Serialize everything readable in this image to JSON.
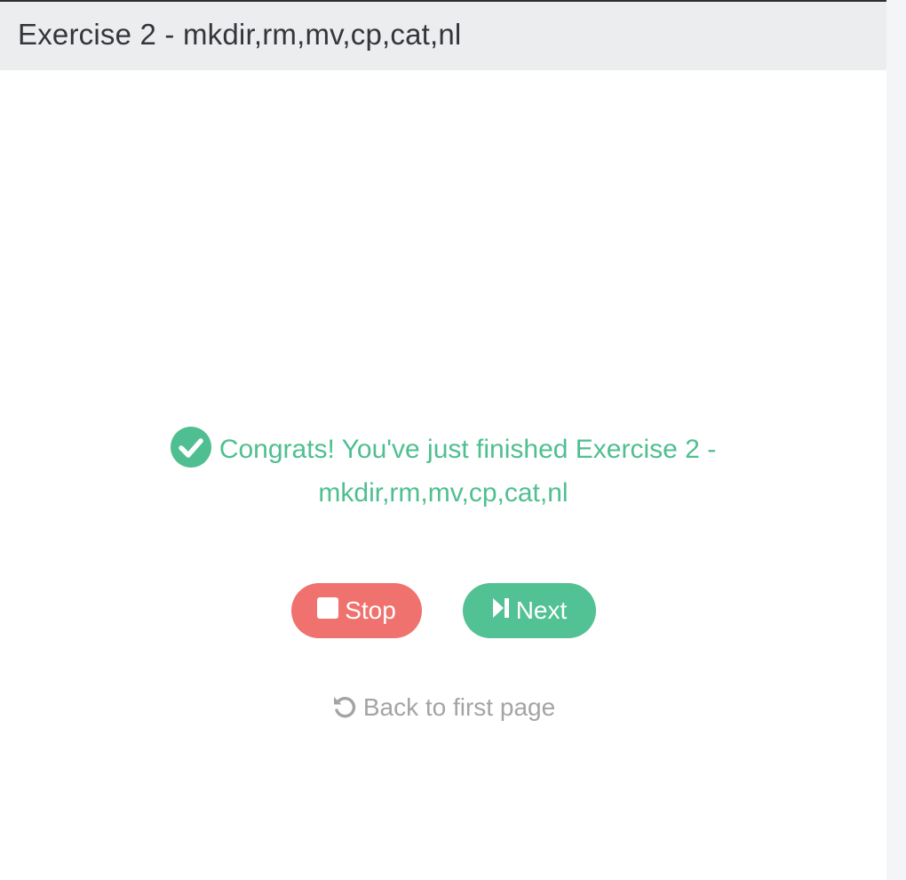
{
  "header": {
    "title": "Exercise 2 - mkdir,rm,mv,cp,cat,nl"
  },
  "message": {
    "line1": "Congrats! You've just finished Exercise 2 -",
    "line2": "mkdir,rm,mv,cp,cat,nl",
    "icon": "check-circle-icon",
    "color": "#4fbf91"
  },
  "actions": {
    "stop_label": "Stop",
    "stop_icon": "stop-square-icon",
    "stop_color": "#ef726e",
    "next_label": "Next",
    "next_icon": "step-forward-icon",
    "next_color": "#52c193"
  },
  "back_link": {
    "label": "Back to first page",
    "icon": "undo-arrow-icon",
    "color": "#a3a4a6"
  }
}
